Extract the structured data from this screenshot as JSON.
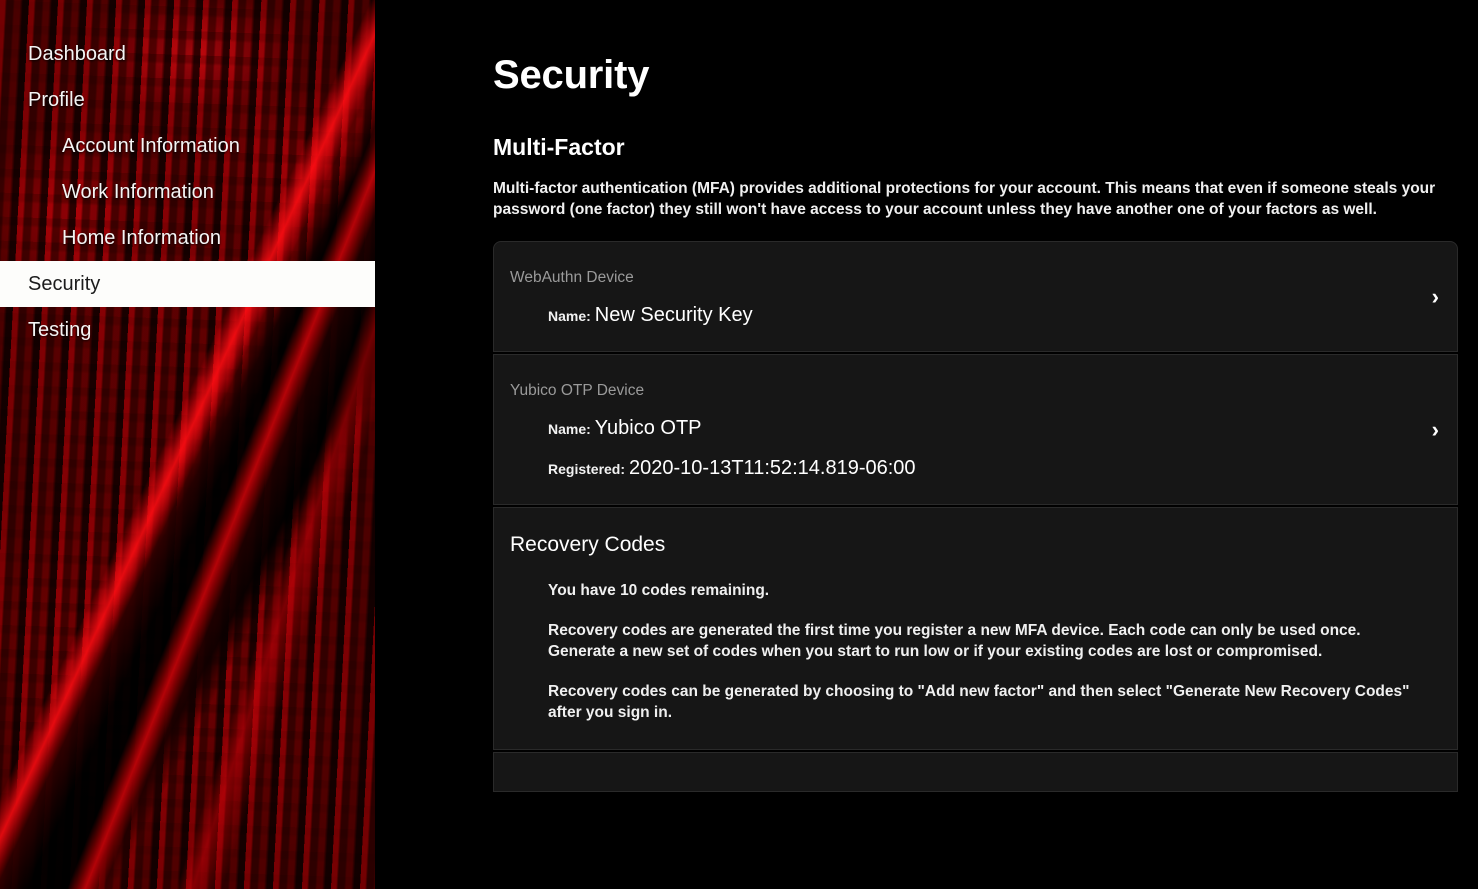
{
  "colors": {
    "page_background": "#000000",
    "card_background": "#161616",
    "card_border": "#2a2a2a",
    "sidebar_tint": "#2b0508",
    "accent_red": "#d62024",
    "active_nav_background": "#fdfdfb",
    "active_nav_text": "#1c1c1c",
    "muted_text": "#9a9a9a"
  },
  "sidebar": {
    "items": [
      {
        "label": "Dashboard",
        "level": "top",
        "active": false
      },
      {
        "label": "Profile",
        "level": "top",
        "active": false
      },
      {
        "label": "Account Information",
        "level": "sub",
        "active": false
      },
      {
        "label": "Work Information",
        "level": "sub",
        "active": false
      },
      {
        "label": "Home Information",
        "level": "sub",
        "active": false
      },
      {
        "label": "Security",
        "level": "top",
        "active": true
      },
      {
        "label": "Testing",
        "level": "top",
        "active": false
      }
    ]
  },
  "main": {
    "page_title": "Security",
    "section_title": "Multi-Factor",
    "section_description": "Multi-factor authentication (MFA) provides additional protections for your account. This means that even if someone steals your password (one factor) they still won't have access to your account unless they have another one of your factors as well.",
    "cards": [
      {
        "kicker": "WebAuthn Device",
        "chevron": "›",
        "rows": [
          {
            "label": "Name:",
            "value": "New Security Key"
          }
        ]
      },
      {
        "kicker": "Yubico OTP Device",
        "chevron": "›",
        "rows": [
          {
            "label": "Name:",
            "value": "Yubico OTP"
          },
          {
            "label": "Registered:",
            "value": "2020-10-13T11:52:14.819-06:00"
          }
        ]
      }
    ],
    "recovery_codes": {
      "heading": "Recovery Codes",
      "paragraphs": [
        "You have 10 codes remaining.",
        "Recovery codes are generated the first time you register a new MFA device. Each code can only be used once. Generate a new set of codes when you start to run low or if your existing codes are lost or compromised.",
        "Recovery codes can be generated by choosing to \"Add new factor\" and then select \"Generate New Recovery Codes\" after you sign in."
      ]
    }
  }
}
